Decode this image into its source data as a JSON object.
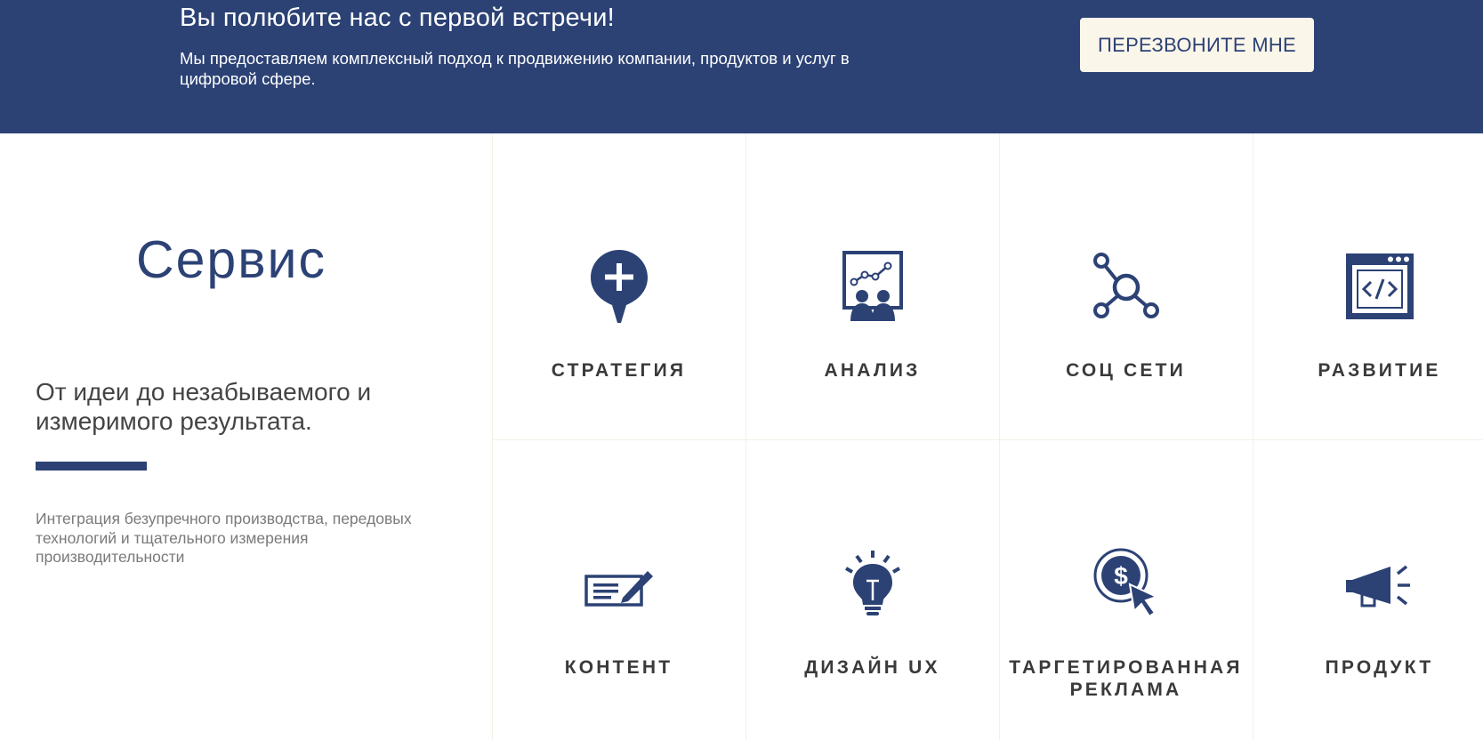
{
  "banner": {
    "title": "Вы полюбите нас с первой встречи!",
    "text": "Мы предоставляем комплексный подход к продвижению компании, продуктов и услуг в цифровой сфере.",
    "button_label": "ПЕРЕЗВОНИТЕ МНЕ"
  },
  "service": {
    "title": "Сервис",
    "subtitle": "От идеи до незабываемого и измеримого результата.",
    "description": "Интеграция безупречного производства, передовых технологий и тщательного измерения производительности"
  },
  "services": [
    {
      "label": "СТРАТЕГИЯ",
      "icon": "plus-pin-icon"
    },
    {
      "label": "АНАЛИЗ",
      "icon": "analytics-board-icon"
    },
    {
      "label": "СОЦ СЕТИ",
      "icon": "network-nodes-icon"
    },
    {
      "label": "РАЗВИТИЕ",
      "icon": "code-window-icon"
    },
    {
      "label": "КОНТЕНТ",
      "icon": "document-pen-icon"
    },
    {
      "label": "ДИЗАЙН UX",
      "icon": "lightbulb-icon"
    },
    {
      "label": "ТАРГЕТИРОВАННАЯ РЕКЛАМА",
      "icon": "dollar-click-icon"
    },
    {
      "label": "ПРОДУКТ",
      "icon": "megaphone-icon"
    }
  ],
  "colors": {
    "brand": "#2c4275",
    "button_bg": "#fbf6ea",
    "label_text": "#3a3a3a",
    "muted_text": "#7a7a7a"
  }
}
